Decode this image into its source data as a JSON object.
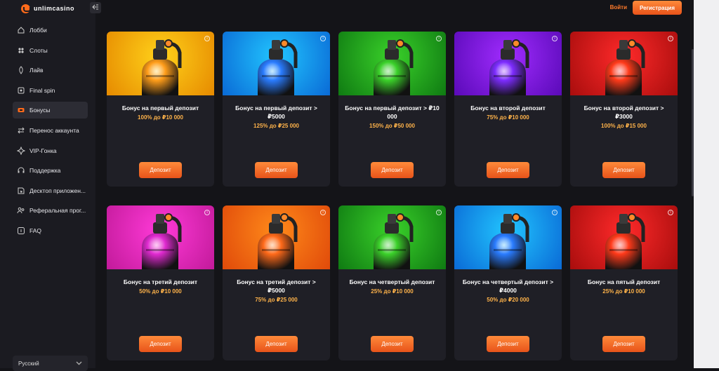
{
  "brand": {
    "name": "unlimcasino",
    "logo_color": "#ff6a1a"
  },
  "sidebar": {
    "collapse_icon": "collapse-sidebar-icon",
    "items": [
      {
        "label": "Лобби",
        "icon": "home-icon",
        "active": false
      },
      {
        "label": "Слоты",
        "icon": "slots-icon",
        "active": false
      },
      {
        "label": "Лайв",
        "icon": "live-icon",
        "active": false
      },
      {
        "label": "Final spin",
        "icon": "spin-icon",
        "active": false
      },
      {
        "label": "Бонусы",
        "icon": "bonus-icon",
        "active": true
      },
      {
        "label": "Перенос аккаунта",
        "icon": "transfer-icon",
        "active": false
      },
      {
        "label": "VIP-Гонка",
        "icon": "vip-icon",
        "active": false
      },
      {
        "label": "Поддержка",
        "icon": "support-icon",
        "active": false
      },
      {
        "label": "Десктоп приложен...",
        "icon": "desktop-icon",
        "active": false
      },
      {
        "label": "Реферальная прог...",
        "icon": "referral-icon",
        "active": false
      },
      {
        "label": "FAQ",
        "icon": "faq-icon",
        "active": false
      }
    ],
    "language": "Русский"
  },
  "header": {
    "login_label": "Войти",
    "register_label": "Регистрация"
  },
  "accent_color": "#ff6a1a",
  "bonuses": [
    {
      "title": "Бонус на первый депозит",
      "subtitle": "100% до ₽10 000",
      "button": "Депозит",
      "bg": [
        "#ffd21a",
        "#e68a00"
      ],
      "bottle": "#ff9d1a"
    },
    {
      "title": "Бонус на первый депозит > ₽5000",
      "subtitle": "125% до ₽25 000",
      "button": "Депозит",
      "bg": [
        "#22c6ff",
        "#0a6ad6"
      ],
      "bottle": "#2a7cff"
    },
    {
      "title": "Бонус на первый депозит > ₽10 000",
      "subtitle": "150% до ₽50 000",
      "button": "Депозит",
      "bg": [
        "#3ad12a",
        "#0f7a12"
      ],
      "bottle": "#3bd12a"
    },
    {
      "title": "Бонус на второй депозит",
      "subtitle": "75% до ₽10 000",
      "button": "Депозит",
      "bg": [
        "#a12cff",
        "#5a0ab8"
      ],
      "bottle": "#7d2cff"
    },
    {
      "title": "Бонус на второй депозит > ₽3000",
      "subtitle": "100% до ₽15 000",
      "button": "Депозит",
      "bg": [
        "#ff2a2a",
        "#a80d0d"
      ],
      "bottle": "#ff3a1a"
    },
    {
      "title": "Бонус на третий депозит",
      "subtitle": "50% до ₽10 000",
      "button": "Депозит",
      "bg": [
        "#ff3ad8",
        "#c21a9a"
      ],
      "bottle": "#e02ad0"
    },
    {
      "title": "Бонус на третий депозит > ₽5000",
      "subtitle": "75% до ₽25 000",
      "button": "Депозит",
      "bg": [
        "#ff8a1a",
        "#e04a0a"
      ],
      "bottle": "#ff6a1a"
    },
    {
      "title": "Бонус на четвертый депозит",
      "subtitle": "25% до ₽10 000",
      "button": "Депозит",
      "bg": [
        "#3ad12a",
        "#0f7a12"
      ],
      "bottle": "#3bd12a"
    },
    {
      "title": "Бонус на четвертый депозит > ₽4000",
      "subtitle": "50% до ₽20 000",
      "button": "Депозит",
      "bg": [
        "#22c6ff",
        "#0a6ad6"
      ],
      "bottle": "#2a7cff"
    },
    {
      "title": "Бонус на пятый депозит",
      "subtitle": "25% до ₽10 000",
      "button": "Депозит",
      "bg": [
        "#ff2a2a",
        "#a80d0d"
      ],
      "bottle": "#ff3a1a"
    }
  ]
}
